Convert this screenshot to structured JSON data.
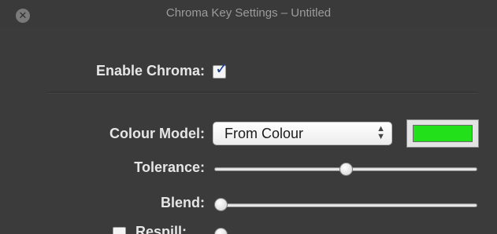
{
  "window": {
    "title": "Chroma Key Settings – Untitled"
  },
  "enable_chroma": {
    "label": "Enable Chroma:",
    "checked": true
  },
  "colour_model": {
    "label": "Colour Model:",
    "value": "From Colour",
    "swatch_color": "#22e01a"
  },
  "tolerance": {
    "label": "Tolerance:",
    "level": 0.5
  },
  "blend": {
    "label": "Blend:",
    "level": 0.0
  },
  "respill": {
    "label": "Respill:",
    "checked": false,
    "level": 0.0
  },
  "icons": {
    "close": "close-icon",
    "checkmark": "checkmark-icon",
    "popup_arrows": "chevron-up-down-icon"
  }
}
